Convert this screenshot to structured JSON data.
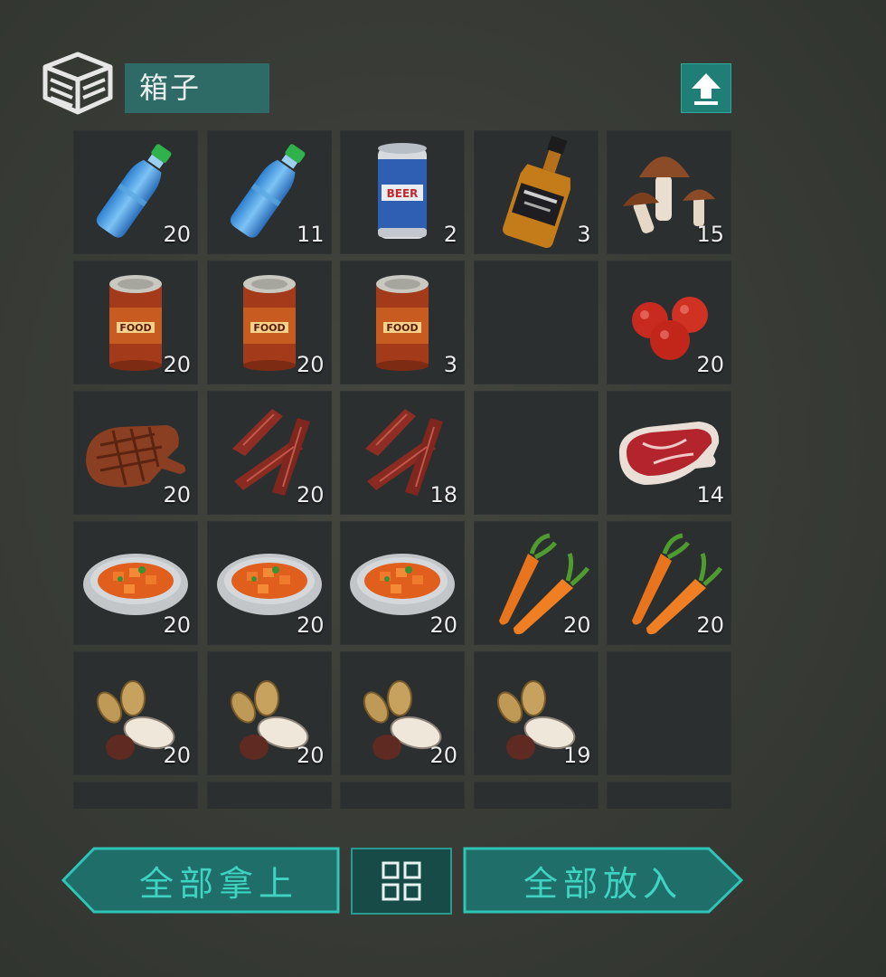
{
  "container": {
    "title": "箱子"
  },
  "icons": {
    "container_icon": "box-icon",
    "transfer_icon": "upload-arrow-icon",
    "sort_icon": "sort-grid-icon"
  },
  "slots": [
    {
      "item": "water-bottle",
      "count": "20"
    },
    {
      "item": "water-bottle",
      "count": "11"
    },
    {
      "item": "beer-can",
      "count": "2"
    },
    {
      "item": "whiskey-bottle",
      "count": "3"
    },
    {
      "item": "mushrooms",
      "count": "15"
    },
    {
      "item": "canned-food",
      "count": "20"
    },
    {
      "item": "canned-food",
      "count": "20"
    },
    {
      "item": "canned-food",
      "count": "3"
    },
    {
      "item": "empty",
      "count": ""
    },
    {
      "item": "tomatoes",
      "count": "20"
    },
    {
      "item": "grilled-steak",
      "count": "20"
    },
    {
      "item": "jerky",
      "count": "20"
    },
    {
      "item": "jerky",
      "count": "18"
    },
    {
      "item": "empty",
      "count": ""
    },
    {
      "item": "raw-steak",
      "count": "14"
    },
    {
      "item": "carrot-stew",
      "count": "20"
    },
    {
      "item": "carrot-stew",
      "count": "20"
    },
    {
      "item": "carrot-stew",
      "count": "20"
    },
    {
      "item": "carrots",
      "count": "20"
    },
    {
      "item": "carrots",
      "count": "20"
    },
    {
      "item": "seeds",
      "count": "20"
    },
    {
      "item": "seeds",
      "count": "20"
    },
    {
      "item": "seeds",
      "count": "20"
    },
    {
      "item": "seeds",
      "count": "19"
    },
    {
      "item": "empty",
      "count": ""
    },
    {
      "item": "empty",
      "count": ""
    },
    {
      "item": "empty",
      "count": ""
    },
    {
      "item": "empty",
      "count": ""
    },
    {
      "item": "empty",
      "count": ""
    },
    {
      "item": "empty",
      "count": ""
    }
  ],
  "actions": {
    "take_all": "全部拿上",
    "put_all": "全部放入"
  },
  "colors": {
    "accent": "#2ea79d",
    "button_text": "#3fd3c2",
    "slot_bg": "#2b2f2f",
    "title_bg": "#2f6b66"
  }
}
